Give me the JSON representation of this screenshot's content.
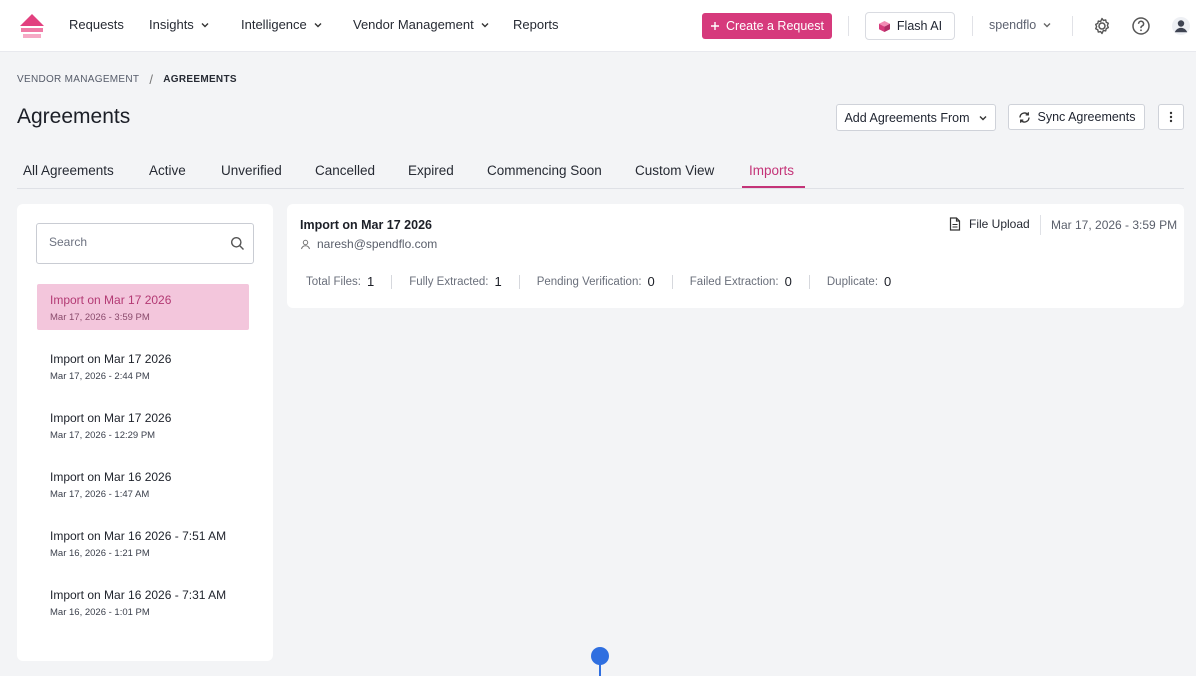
{
  "nav": {
    "items": [
      {
        "label": "Requests"
      },
      {
        "label": "Insights"
      },
      {
        "label": "Intelligence"
      },
      {
        "label": "Vendor Management"
      },
      {
        "label": "Reports"
      }
    ],
    "create_button": "Create a Request",
    "flash_button": "Flash AI",
    "org_name": "spendflo"
  },
  "breadcrumb": {
    "parent": "VENDOR MANAGEMENT",
    "separator": "/",
    "current": "AGREEMENTS"
  },
  "page": {
    "title": "Agreements",
    "add_button": "Add Agreements From",
    "sync_button": "Sync Agreements"
  },
  "tabs": [
    {
      "label": "All Agreements"
    },
    {
      "label": "Active"
    },
    {
      "label": "Unverified"
    },
    {
      "label": "Cancelled"
    },
    {
      "label": "Expired"
    },
    {
      "label": "Commencing Soon"
    },
    {
      "label": "Custom View"
    },
    {
      "label": "Imports"
    }
  ],
  "search": {
    "placeholder": "Search"
  },
  "imports": [
    {
      "title": "Import on Mar 17 2026",
      "date": "Mar 17, 2026 - 3:59 PM"
    },
    {
      "title": "Import on Mar 17 2026",
      "date": "Mar 17, 2026 - 2:44 PM"
    },
    {
      "title": "Import on Mar 17 2026",
      "date": "Mar 17, 2026 - 12:29 PM"
    },
    {
      "title": "Import on Mar 16 2026",
      "date": "Mar 17, 2026 - 1:47 AM"
    },
    {
      "title": "Import on Mar 16 2026 - 7:51 AM",
      "date": "Mar 16, 2026 - 1:21 PM"
    },
    {
      "title": "Import on Mar 16 2026 - 7:31 AM",
      "date": "Mar 16, 2026 - 1:01 PM"
    }
  ],
  "detail": {
    "title": "Import on Mar 17 2026",
    "user": "naresh@spendflo.com",
    "source": "File Upload",
    "date": "Mar 17, 2026 - 3:59 PM",
    "stats": [
      {
        "label": "Total Files:",
        "value": "1"
      },
      {
        "label": "Fully Extracted:",
        "value": "1"
      },
      {
        "label": "Pending Verification:",
        "value": "0"
      },
      {
        "label": "Failed Extraction:",
        "value": "0"
      },
      {
        "label": "Duplicate:",
        "value": "0"
      }
    ]
  },
  "colors": {
    "brand": "#d63a7c",
    "active_tab": "#c43478",
    "selected_item": "#f3c6dc",
    "marker": "#2f6fe0"
  }
}
